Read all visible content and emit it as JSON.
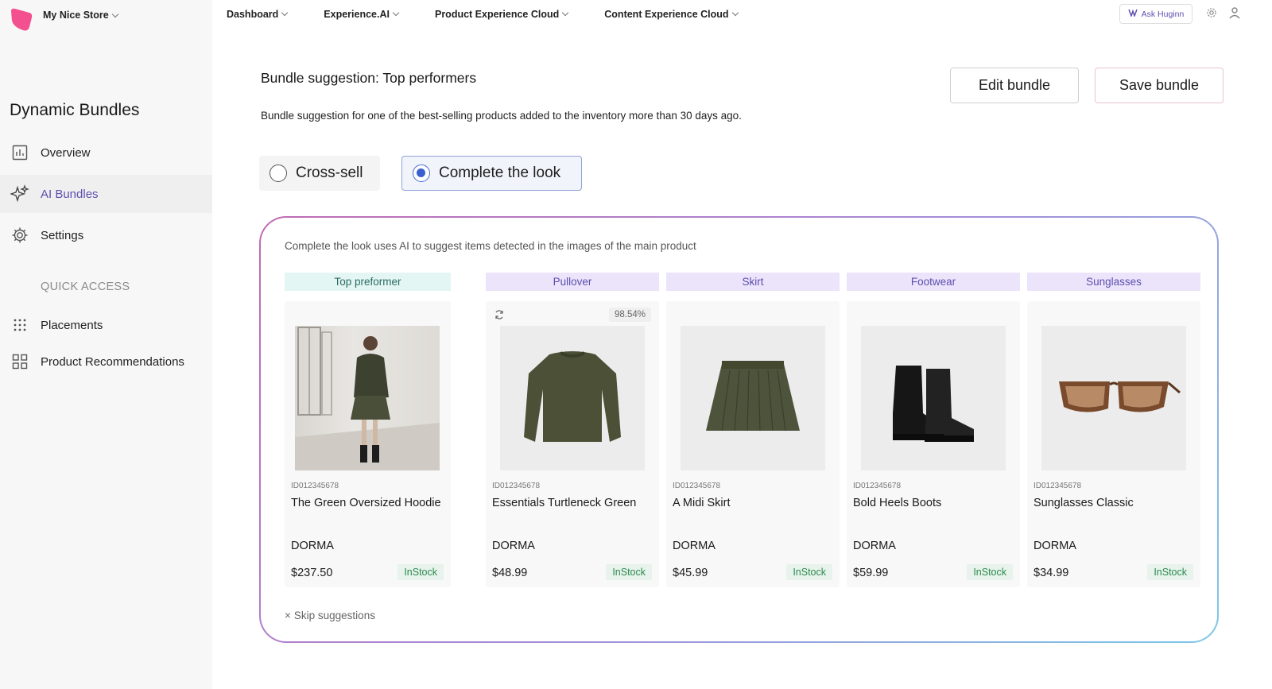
{
  "store": {
    "name": "My Nice Store"
  },
  "sidebar": {
    "title": "Dynamic Bundles",
    "items": [
      {
        "label": "Overview",
        "icon": "chart-icon"
      },
      {
        "label": "AI Bundles",
        "icon": "sparkle-icon",
        "active": true
      },
      {
        "label": "Settings",
        "icon": "gear-icon"
      }
    ],
    "quick_access_label": "QUICK ACCESS",
    "quick_items": [
      {
        "label": "Placements",
        "icon": "dots-grid-icon"
      },
      {
        "label": "Product Recommendations",
        "icon": "widgets-icon"
      }
    ]
  },
  "topnav": {
    "items": [
      "Dashboard",
      "Experience.AI",
      "Product Experience Cloud",
      "Content Experience Cloud"
    ],
    "ask_label": "Ask Huginn"
  },
  "main": {
    "title_prefix": "Bundle suggestion:",
    "title_name": "Top performers",
    "description": "Bundle suggestion for one of the best-selling products added to the inventory more than 30 days ago.",
    "edit_label": "Edit bundle",
    "save_label": "Save bundle",
    "options": [
      {
        "label": "Cross-sell",
        "selected": false
      },
      {
        "label": "Complete the look",
        "selected": true
      }
    ],
    "panel_note": "Complete the look uses AI to suggest items detected in the images of the main product",
    "skip_label": "Skip suggestions",
    "columns": [
      {
        "header": "Top preformer",
        "header_bg": "#e3f6f3",
        "header_color": "#2c6b63",
        "sku": "ID012345678",
        "name": "The Green Oversized Hoodie",
        "brand": "DORMA",
        "price": "$237.50",
        "stock": "InStock",
        "image": "model-photo"
      },
      {
        "header": "Pullover",
        "header_bg": "#ebe4fa",
        "header_color": "#5d4fb0",
        "score": "98.54%",
        "sku": "ID012345678",
        "name": "Essentials Turtleneck Green",
        "brand": "DORMA",
        "price": "$48.99",
        "stock": "InStock",
        "image": "sweater"
      },
      {
        "header": "Skirt",
        "header_bg": "#ebe4fa",
        "header_color": "#5d4fb0",
        "sku": "ID012345678",
        "name": "A Midi Skirt",
        "brand": "DORMA",
        "price": "$45.99",
        "stock": "InStock",
        "image": "skirt"
      },
      {
        "header": "Footwear",
        "header_bg": "#ebe4fa",
        "header_color": "#5d4fb0",
        "sku": "ID012345678",
        "name": "Bold Heels Boots",
        "brand": "DORMA",
        "price": "$59.99",
        "stock": "InStock",
        "image": "boots"
      },
      {
        "header": "Sunglasses",
        "header_bg": "#ebe4fa",
        "header_color": "#5d4fb0",
        "sku": "ID012345678",
        "name": "Sunglasses Classic",
        "brand": "DORMA",
        "price": "$34.99",
        "stock": "InStock",
        "image": "sunglasses"
      }
    ]
  },
  "colors": {
    "accent": "#5d4fb0",
    "radio_selected": "#3a5fd0",
    "stock_green": "#2c8a4f"
  }
}
